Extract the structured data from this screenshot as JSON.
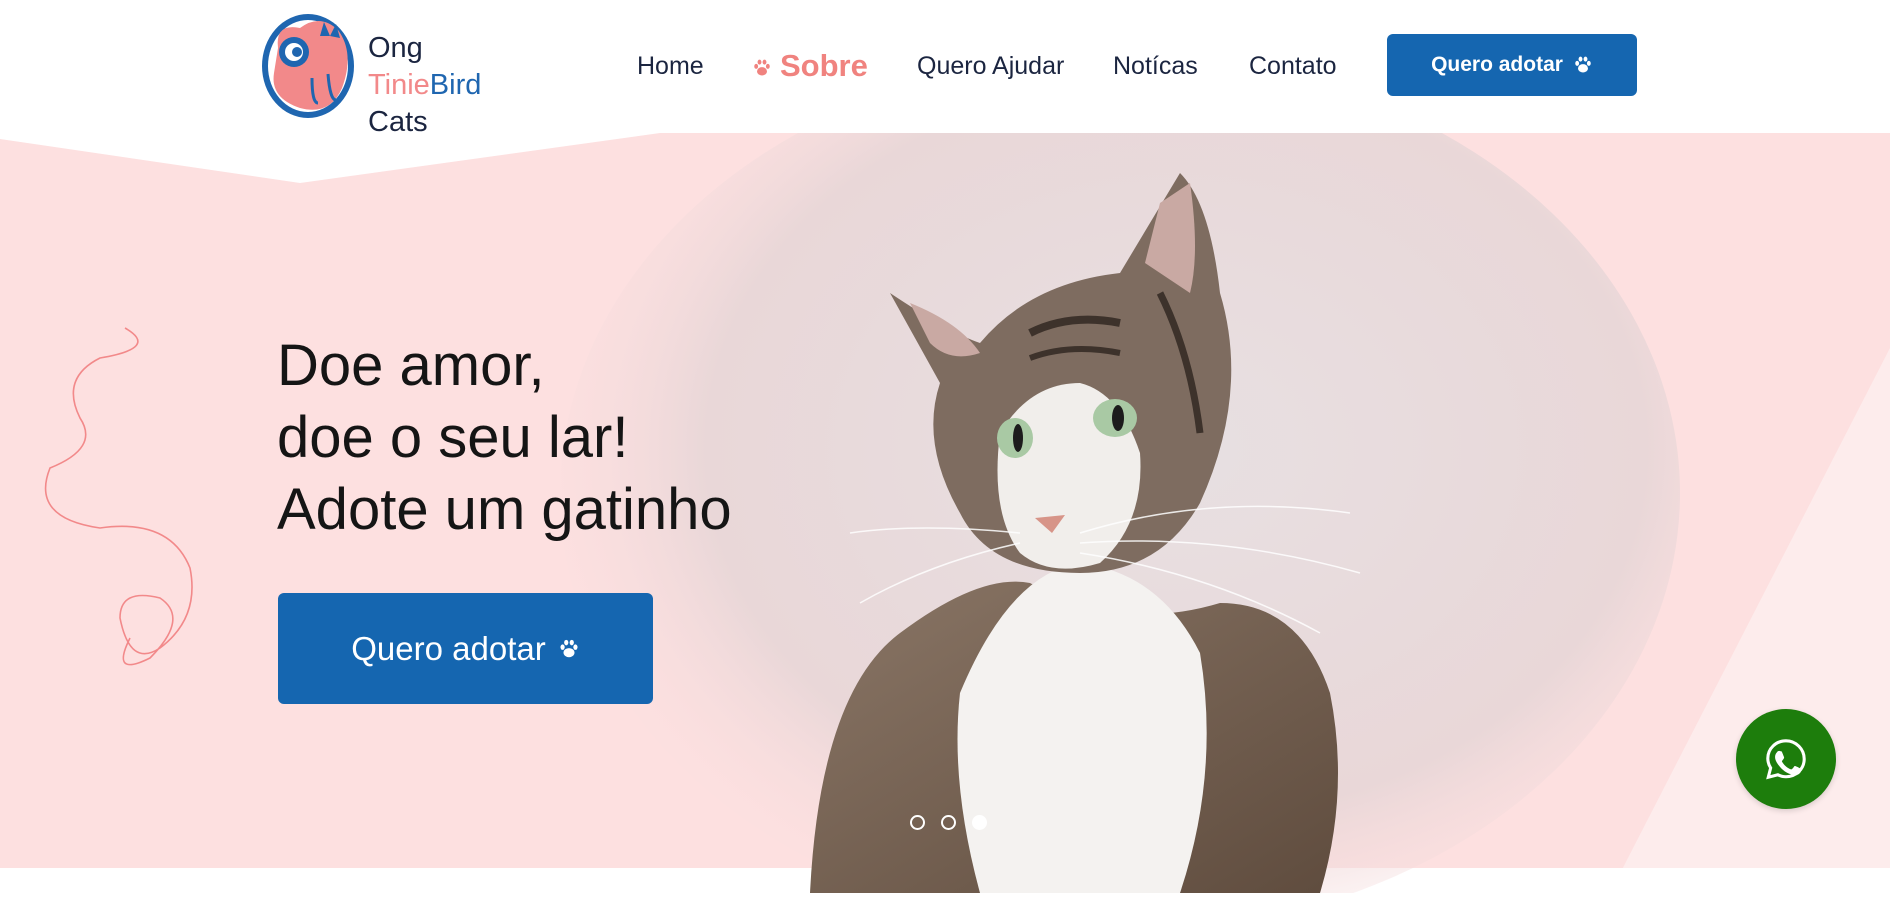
{
  "header": {
    "logo": {
      "line1": "Ong",
      "line2_pink": "Tinie",
      "line2_blue": "Bird",
      "line3": "Cats",
      "icon": "cat-logo-icon"
    },
    "nav": [
      {
        "label": "Home",
        "active": false
      },
      {
        "label": "Sobre",
        "active": true,
        "icon": "paw-icon"
      },
      {
        "label": "Quero Ajudar",
        "active": false
      },
      {
        "label": "Notícas",
        "active": false
      },
      {
        "label": "Contato",
        "active": false
      }
    ],
    "cta_label": "Quero adotar",
    "cta_icon": "paw-icon"
  },
  "hero": {
    "title_lines": [
      "Doe amor,",
      "doe o seu lar!",
      "Adote um gatinho"
    ],
    "cta_label": "Quero adotar",
    "cta_icon": "paw-icon",
    "carousel": {
      "slides": 3,
      "active_index": 2
    }
  },
  "whatsapp": {
    "icon": "whatsapp-icon"
  },
  "colors": {
    "primary_blue": "#1566b0",
    "accent_pink": "#f0837f",
    "hero_bg_pink": "#fde0e0",
    "text_dark": "#1b2540",
    "whatsapp_green": "#1d7d0c"
  }
}
